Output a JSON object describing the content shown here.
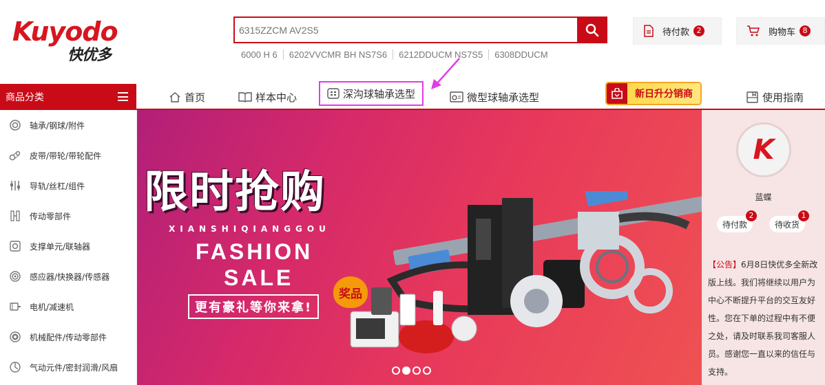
{
  "brand": {
    "name_en": "Kuyodo",
    "name_cn": "快优多"
  },
  "search": {
    "placeholder": "6315ZZCM AV2S5",
    "hot_words": [
      "6000 H 6",
      "6202VVCMR BH NS7S6",
      "6212DDUCM NS7S5",
      "6308DDUCM"
    ]
  },
  "header": {
    "pending_pay": {
      "label": "待付款",
      "count": "2"
    },
    "cart": {
      "label": "购物车",
      "count": "8"
    }
  },
  "nav": {
    "category_label": "商品分类",
    "items": [
      {
        "label": "首页",
        "icon": "home-icon"
      },
      {
        "label": "样本中心",
        "icon": "book-icon"
      },
      {
        "label": "深沟球轴承选型",
        "icon": "grid-icon"
      },
      {
        "label": "微型球轴承选型",
        "icon": "bearing-icon"
      },
      {
        "label": "使用指南",
        "icon": "guide-icon"
      }
    ],
    "promo": "新日升分销商"
  },
  "categories": [
    {
      "label": "轴承/钢球/附件",
      "icon": "bearing-icon"
    },
    {
      "label": "皮带/带轮/带轮配件",
      "icon": "belt-icon"
    },
    {
      "label": "导轨/丝杠/组件",
      "icon": "rail-icon"
    },
    {
      "label": "传动零部件",
      "icon": "coupling-icon"
    },
    {
      "label": "支撑单元/联轴器",
      "icon": "support-icon"
    },
    {
      "label": "感应器/快换器/传感器",
      "icon": "sensor-icon"
    },
    {
      "label": "电机/减速机",
      "icon": "motor-icon"
    },
    {
      "label": "机械配件/传动零部件",
      "icon": "mech-icon"
    },
    {
      "label": "气动元件/密封润滑/风扇",
      "icon": "pneumatic-icon"
    }
  ],
  "banner": {
    "title": "限时抢购",
    "pinyin": "XIANSHIQIANGGOU",
    "line1": "FASHION",
    "line2": "SALE",
    "gift": "更有豪礼等你来拿!",
    "prize": "奖品",
    "slides": 4,
    "active_slide": 2
  },
  "user": {
    "avatar_letter": "K",
    "name": "蓝蝶",
    "pending_pay": {
      "label": "待付款",
      "count": "2"
    },
    "pending_receive": {
      "label": "待收货",
      "count": "1"
    }
  },
  "notice": {
    "tag": "【公告】",
    "text": "6月8日快优多全新改版上线。我们将继续以用户为中心不断提升平台的交互友好性。您在下单的过程中有不便之处，请及时联系我司客服人员。感谢您一直以来的信任与支持。"
  },
  "colors": {
    "brand_red": "#c90b17",
    "highlight": "#e33be8",
    "promo_yellow": "#ffd94d"
  }
}
